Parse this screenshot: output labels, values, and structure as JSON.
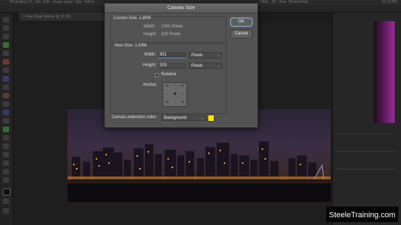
{
  "app": {
    "menu_items": [
      "Photoshop CC",
      "File",
      "Edit",
      "Image",
      "Layer",
      "Type",
      "Select",
      "Filter",
      "3D",
      "View",
      "Window",
      "Help"
    ],
    "system_status": "11:13 PM",
    "doc_tab": "×  San Diego Skyline @ 33.3%"
  },
  "dialog": {
    "title": "Canvas Size",
    "current_size_label": "Current Size: 1.80M",
    "current_width_label": "Width:",
    "current_width_value": "1001 Pixels",
    "current_height_label": "Height:",
    "current_height_value": "315 Pixels",
    "new_size_label": "New Size: 1.53M",
    "width_label": "Width:",
    "width_value": "851",
    "width_unit": "Pixels",
    "height_label": "Height:",
    "height_value": "315",
    "height_unit": "Pixels",
    "relative_label": "Relative",
    "relative_checked": false,
    "anchor_label": "Anchor:",
    "anchor_arrows": [
      "↖",
      "↑",
      "↗",
      "←",
      "■",
      "→",
      "↙",
      "↓",
      "↘"
    ],
    "extension_label": "Canvas extension color:",
    "extension_value": "Background",
    "extension_color": "#ffe600",
    "ok_label": "OK",
    "cancel_label": "Cancel"
  },
  "watermark": "SteeleTraining.com",
  "colors": {
    "dialog_bg": "#535353",
    "accent": "#6a8fcf"
  }
}
